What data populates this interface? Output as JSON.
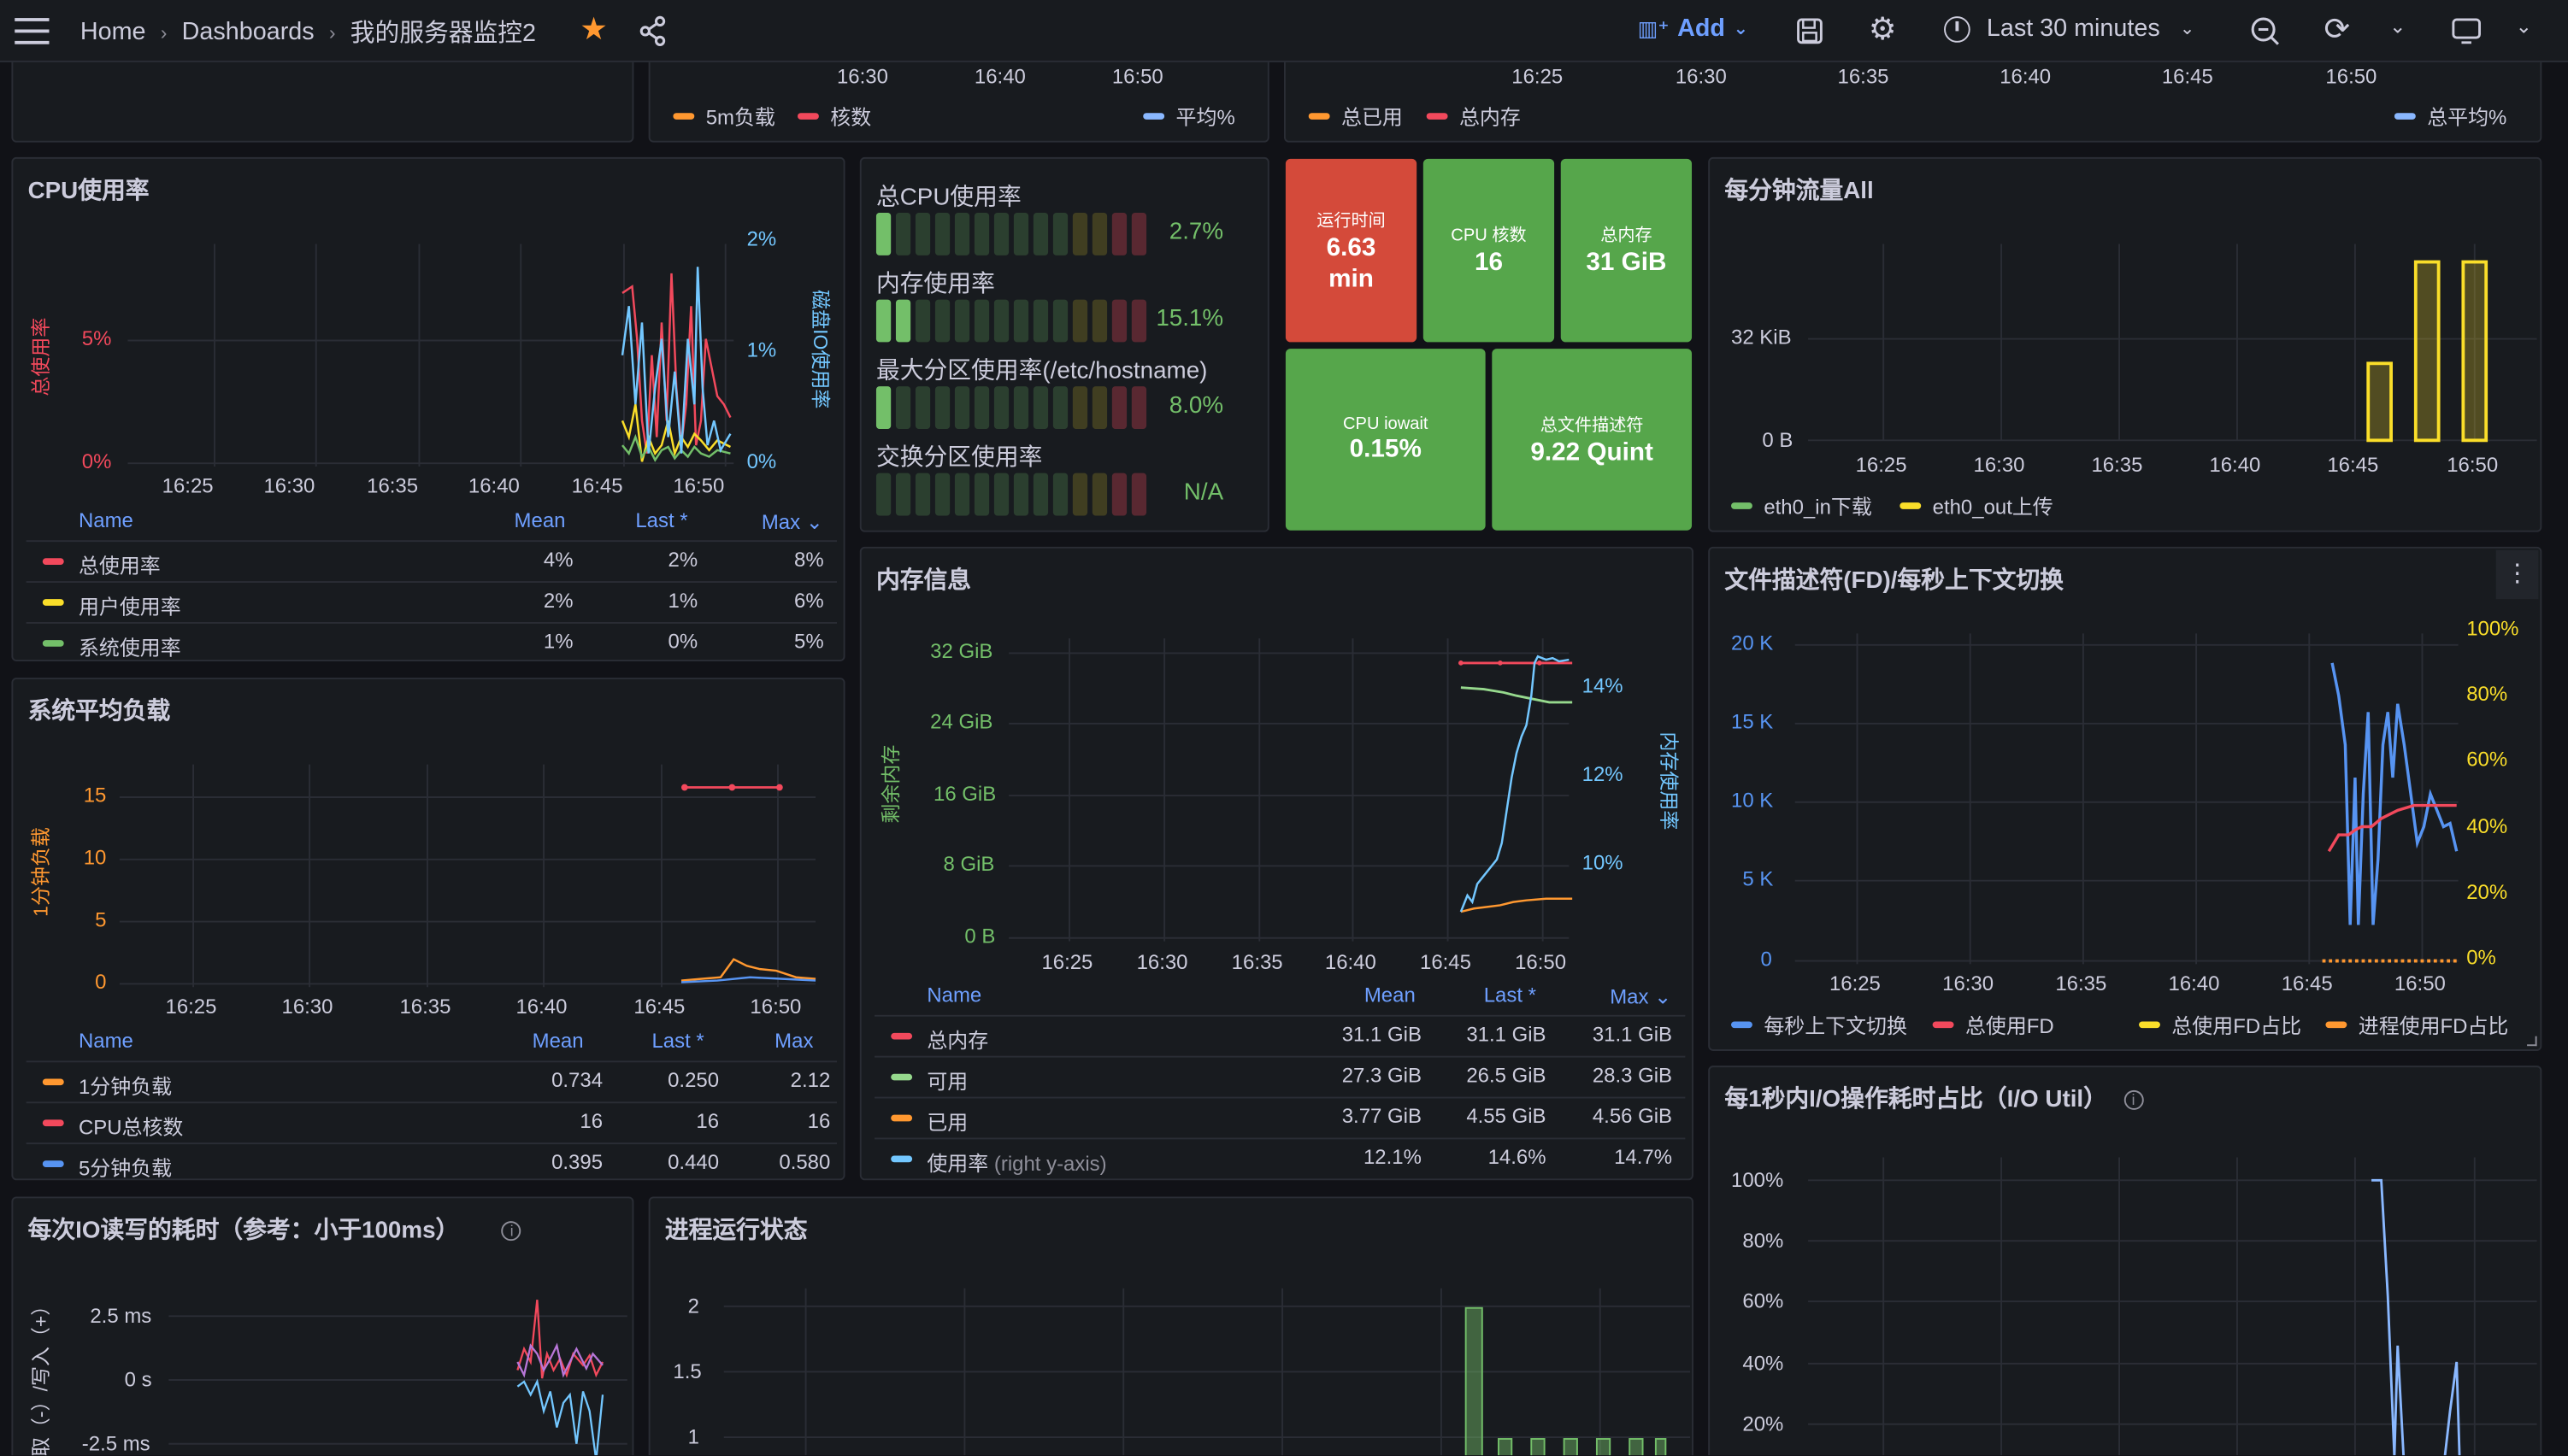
{
  "topbar": {
    "crumbs": [
      "Home",
      "Dashboards",
      "我的服务器监控2"
    ],
    "add_label": "Add",
    "time_range": "Last 30 minutes"
  },
  "top_panels": {
    "load_legend": [
      "5m负载",
      "核数",
      "平均%"
    ],
    "load_ticks": [
      "16:30",
      "16:40",
      "16:50"
    ],
    "mem_legend": [
      "总已用",
      "总内存",
      "总平均%"
    ],
    "mem_ticks": [
      "16:25",
      "16:30",
      "16:35",
      "16:40",
      "16:45",
      "16:50"
    ]
  },
  "colors": {
    "green": "#73bf69",
    "red": "#f2495c",
    "yellow": "#fade2a",
    "orange": "#ff9830",
    "blue": "#5794f2",
    "cyan": "#8ab8ff",
    "lightblue": "#73c7ff",
    "purple": "#b877d9"
  },
  "cpu": {
    "title": "CPU使用率",
    "y_left": [
      "5%",
      "0%"
    ],
    "y_right": [
      "2%",
      "1%",
      "0%"
    ],
    "ylabel_left": "总使用率",
    "ylabel_right": "磁盘IO使用率",
    "x_ticks": [
      "16:25",
      "16:30",
      "16:35",
      "16:40",
      "16:45",
      "16:50"
    ],
    "legend_headers": [
      "Name",
      "Mean",
      "Last *",
      "Max"
    ],
    "legend_rows": [
      {
        "name": "总使用率",
        "mean": "4%",
        "last": "2%",
        "max": "8%"
      },
      {
        "name": "用户使用率",
        "mean": "2%",
        "last": "1%",
        "max": "6%"
      },
      {
        "name": "系统使用率",
        "mean": "1%",
        "last": "0%",
        "max": "5%"
      }
    ]
  },
  "bargauge": {
    "rows": [
      {
        "label": "总CPU使用率",
        "value": "2.7%",
        "fraction": 0.027
      },
      {
        "label": "内存使用率",
        "value": "15.1%",
        "fraction": 0.151
      },
      {
        "label": "最大分区使用率(/etc/hostname)",
        "value": "8.0%",
        "fraction": 0.08
      },
      {
        "label": "交换分区使用率",
        "value": "N/A",
        "fraction": 0
      }
    ]
  },
  "stats": {
    "uptime": {
      "label": "运行时间",
      "value": "6.63",
      "unit": "min"
    },
    "cores": {
      "label": "CPU 核数",
      "value": "16"
    },
    "memory": {
      "label": "总内存",
      "value": "31 GiB"
    },
    "iowait": {
      "label": "CPU iowait",
      "value": "0.15%"
    },
    "fd": {
      "label": "总文件描述符",
      "value": "9.22 Quint"
    }
  },
  "traffic": {
    "title": "每分钟流量All",
    "y_ticks": [
      "32 KiB",
      "0 B"
    ],
    "x_ticks": [
      "16:25",
      "16:30",
      "16:35",
      "16:40",
      "16:45",
      "16:50"
    ],
    "legend": [
      "eth0_in下载",
      "eth0_out上传"
    ]
  },
  "load": {
    "title": "系统平均负载",
    "ylabel": "1分钟负载",
    "y_ticks": [
      "15",
      "10",
      "5",
      "0"
    ],
    "x_ticks": [
      "16:25",
      "16:30",
      "16:35",
      "16:40",
      "16:45",
      "16:50"
    ],
    "legend_headers": [
      "Name",
      "Mean",
      "Last *",
      "Max"
    ],
    "legend_rows": [
      {
        "name": "1分钟负载",
        "mean": "0.734",
        "last": "0.250",
        "max": "2.12"
      },
      {
        "name": "CPU总核数",
        "mean": "16",
        "last": "16",
        "max": "16"
      },
      {
        "name": "5分钟负载",
        "mean": "0.395",
        "last": "0.440",
        "max": "0.580"
      }
    ]
  },
  "meminfo": {
    "title": "内存信息",
    "y_left": [
      "32 GiB",
      "24 GiB",
      "16 GiB",
      "8 GiB",
      "0 B"
    ],
    "y_right": [
      "14%",
      "12%",
      "10%"
    ],
    "ylabel_left": "剩余内存",
    "ylabel_right": "内存使用率",
    "x_ticks": [
      "16:25",
      "16:30",
      "16:35",
      "16:40",
      "16:45",
      "16:50"
    ],
    "legend_headers": [
      "Name",
      "Mean",
      "Last *",
      "Max"
    ],
    "legend_rows": [
      {
        "name": "总内存",
        "mean": "31.1 GiB",
        "last": "31.1 GiB",
        "max": "31.1 GiB"
      },
      {
        "name": "可用",
        "mean": "27.3 GiB",
        "last": "26.5 GiB",
        "max": "28.3 GiB"
      },
      {
        "name": "已用",
        "mean": "3.77 GiB",
        "last": "4.55 GiB",
        "max": "4.56 GiB"
      },
      {
        "name": "使用率",
        "suffix": "(right y-axis)",
        "mean": "12.1%",
        "last": "14.6%",
        "max": "14.7%"
      }
    ]
  },
  "fdctx": {
    "title": "文件描述符(FD)/每秒上下文切换",
    "y_left": [
      "20 K",
      "15 K",
      "10 K",
      "5 K",
      "0"
    ],
    "y_right": [
      "100%",
      "80%",
      "60%",
      "40%",
      "20%",
      "0%"
    ],
    "x_ticks": [
      "16:25",
      "16:30",
      "16:35",
      "16:40",
      "16:45",
      "16:50"
    ],
    "legend": [
      "每秒上下文切换",
      "总使用FD",
      "总使用FD占比",
      "进程使用FD占比"
    ]
  },
  "ioutil": {
    "title": "每1秒内I/O操作耗时占比（I/O Util）",
    "y_ticks": [
      "100%",
      "80%",
      "60%",
      "40%",
      "20%"
    ]
  },
  "iotime": {
    "title": "每次IO读写的耗时（参考：小于100ms）",
    "y_ticks": [
      "2.5 ms",
      "0 s",
      "-2.5 ms"
    ],
    "ylabel": "读取（-）/写入（+）"
  },
  "procs": {
    "title": "进程运行状态",
    "y_ticks": [
      "2",
      "1.5",
      "1"
    ]
  }
}
